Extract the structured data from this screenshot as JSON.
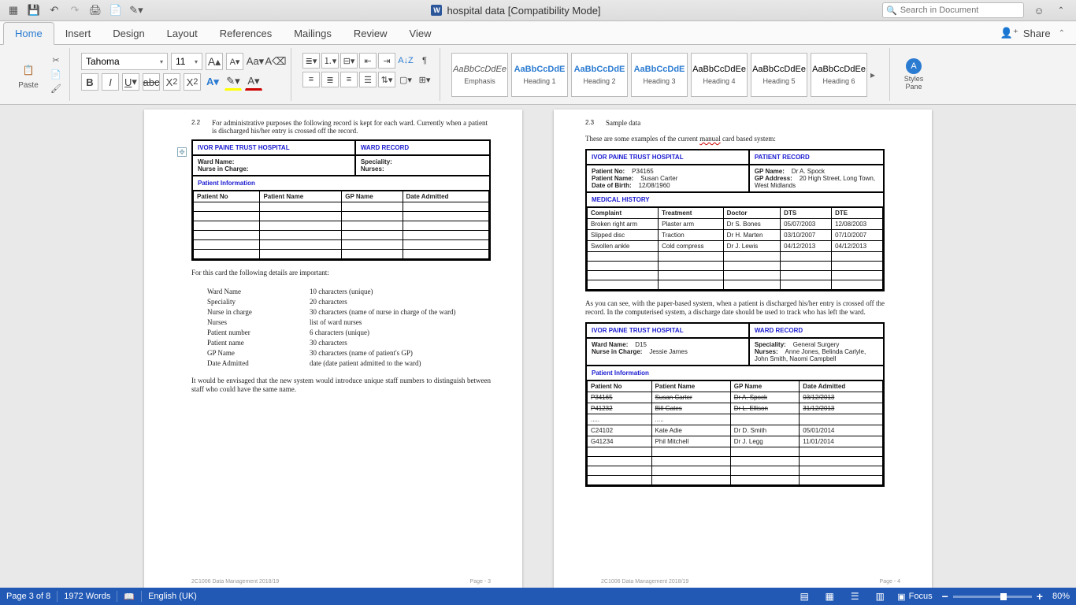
{
  "titlebar": {
    "title": "hospital data [Compatibility Mode]",
    "search_placeholder": "Search in Document"
  },
  "ribbon_tabs": {
    "home": "Home",
    "insert": "Insert",
    "design": "Design",
    "layout": "Layout",
    "references": "References",
    "mailings": "Mailings",
    "review": "Review",
    "view": "View",
    "share": "Share"
  },
  "ribbon": {
    "paste": "Paste",
    "font_name": "Tahoma",
    "font_size": "11",
    "styles": [
      {
        "preview": "AaBbCcDdEe",
        "label": "Emphasis",
        "cls": "emph"
      },
      {
        "preview": "AaBbCcDdE",
        "label": "Heading 1",
        "cls": "blue"
      },
      {
        "preview": "AaBbCcDdE",
        "label": "Heading 2",
        "cls": "blue"
      },
      {
        "preview": "AaBbCcDdE",
        "label": "Heading 3",
        "cls": "blue"
      },
      {
        "preview": "AaBbCcDdEe",
        "label": "Heading 4",
        "cls": ""
      },
      {
        "preview": "AaBbCcDdEe",
        "label": "Heading 5",
        "cls": ""
      },
      {
        "preview": "AaBbCcDdEe",
        "label": "Heading 6",
        "cls": ""
      }
    ],
    "styles_pane": "Styles\nPane"
  },
  "doc": {
    "left": {
      "sec_num": "2.2",
      "sec_text": "For administrative purposes the following record is kept for each ward. Currently when a patient is discharged his/her entry is crossed off the record.",
      "hospital": "IVOR PAINE TRUST HOSPITAL",
      "record_title": "WARD RECORD",
      "meta_l": [
        "Ward Name:",
        "Nurse in Charge:"
      ],
      "meta_r": [
        "Speciality:",
        "Nurses:"
      ],
      "subhdr": "Patient Information",
      "cols": [
        "Patient No",
        "Patient Name",
        "GP Name",
        "Date Admitted"
      ],
      "para2": "For this card the following details are important:",
      "defs": [
        [
          "Ward Name",
          "10 characters (unique)"
        ],
        [
          "Speciality",
          "20 characters"
        ],
        [
          "Nurse in charge",
          "30 characters (name of nurse in charge of the ward)"
        ],
        [
          "Nurses",
          "list of ward nurses"
        ],
        [
          "Patient number",
          "6 characters (unique)"
        ],
        [
          "Patient name",
          "30 characters"
        ],
        [
          "GP Name",
          "30 characters (name of patient's GP)"
        ],
        [
          "Date Admitted",
          "date (date patient admitted to the ward)"
        ]
      ],
      "para3": "It would be envisaged that the new system would introduce unique staff numbers to distinguish between staff who could have the same name.",
      "footer_l": "2C1006 Data Management 2018/19",
      "footer_r": "Page - 3"
    },
    "right": {
      "sec_num": "2.3",
      "sec_text": "Sample data",
      "para1a": "These are some examples of the current ",
      "para1u": "manual",
      "para1b": " card based system:",
      "hospital": "IVOR PAINE TRUST HOSPITAL",
      "patient_title": "PATIENT RECORD",
      "pmeta_l": [
        [
          "Patient No:",
          "P34165"
        ],
        [
          "Patient Name:",
          "Susan Carter"
        ],
        [
          "Date of Birth:",
          "12/08/1960"
        ]
      ],
      "pmeta_r": [
        [
          "GP Name:",
          "Dr A. Spock"
        ],
        [
          "GP Address:",
          "20 High Street, Long Town, West Midlands"
        ]
      ],
      "medhist": "MEDICAL HISTORY",
      "medcols": [
        "Complaint",
        "Treatment",
        "Doctor",
        "DTS",
        "DTE"
      ],
      "medrows": [
        [
          "Broken right arm",
          "Plaster arm",
          "Dr S. Bones",
          "05/07/2003",
          "12/08/2003"
        ],
        [
          "Slipped disc",
          "Traction",
          "Dr H. Marten",
          "03/10/2007",
          "07/10/2007"
        ],
        [
          "Swollen ankle",
          "Cold compress",
          "Dr J. Lewis",
          "04/12/2013",
          "04/12/2013"
        ]
      ],
      "para2": "As you can see, with the paper-based system, when a patient is discharged his/her entry is crossed off the record. In the computerised system, a discharge date should be used to track who has left the ward.",
      "ward_title": "WARD RECORD",
      "wmeta_l": [
        [
          "Ward Name:",
          "D15"
        ],
        [
          "Nurse in Charge:",
          "Jessie James"
        ]
      ],
      "wmeta_r": [
        [
          "Speciality:",
          "General Surgery"
        ],
        [
          "Nurses:",
          "Anne Jones, Belinda Carlyle, John Smith, Naomi Campbell"
        ]
      ],
      "subhdr": "Patient Information",
      "wcols": [
        "Patient No",
        "Patient Name",
        "GP Name",
        "Date Admitted"
      ],
      "wrows": [
        {
          "strike": true,
          "c": [
            "P34165",
            "Susan Carter",
            "Dr A. Spock",
            "03/12/2013"
          ]
        },
        {
          "strike": true,
          "c": [
            "P41232",
            "Bill Gates",
            "Dr L. Ellison",
            "31/12/2013"
          ]
        },
        {
          "strike": false,
          "c": [
            ".....",
            ".....",
            "",
            ""
          ]
        },
        {
          "strike": false,
          "c": [
            "C24102",
            "Kate Adie",
            "Dr D. Smith",
            "05/01/2014"
          ]
        },
        {
          "strike": false,
          "c": [
            "G41234",
            "Phil Mitchell",
            "Dr J. Legg",
            "11/01/2014"
          ]
        }
      ],
      "footer_l": "2C1006 Data Management 2018/19",
      "footer_r": "Page - 4"
    }
  },
  "statusbar": {
    "page": "Page 3 of 8",
    "words": "1972 Words",
    "lang": "English (UK)",
    "focus": "Focus",
    "zoom": "80%"
  }
}
